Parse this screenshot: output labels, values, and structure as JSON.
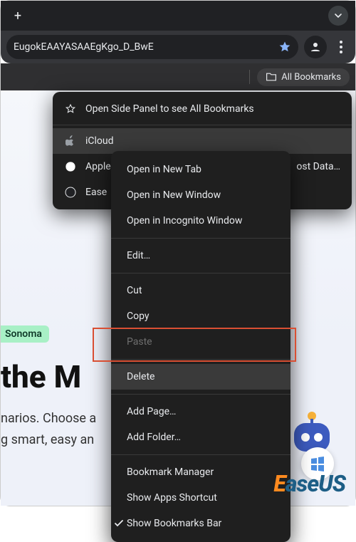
{
  "omnibox": {
    "url_fragment": "EugokEAAYASAAEgKgo_D_BwE"
  },
  "bookmarks_bar": {
    "all_label": "All Bookmarks"
  },
  "bm_dropdown": {
    "header": "Open Side Panel to see All Bookmarks",
    "items": [
      {
        "label": "iCloud"
      },
      {
        "label": "Apple"
      },
      {
        "label": "Ease",
        "trail": "ost Data…"
      }
    ]
  },
  "ctx": {
    "open_tab": "Open in New Tab",
    "open_win": "Open in New Window",
    "open_incog": "Open in Incognito Window",
    "edit": "Edit…",
    "cut": "Cut",
    "copy": "Copy",
    "paste": "Paste",
    "delete": "Delete",
    "add_page": "Add Page…",
    "add_folder": "Add Folder…",
    "bm_manager": "Bookmark Manager",
    "show_apps": "Show Apps Shortcut",
    "show_bar": "Show Bookmarks Bar"
  },
  "page": {
    "badge": "Sonoma",
    "headline": "the M",
    "sub1": "narios. Choose a",
    "sub2": "g smart, easy an"
  },
  "watermark": "EaseUS"
}
